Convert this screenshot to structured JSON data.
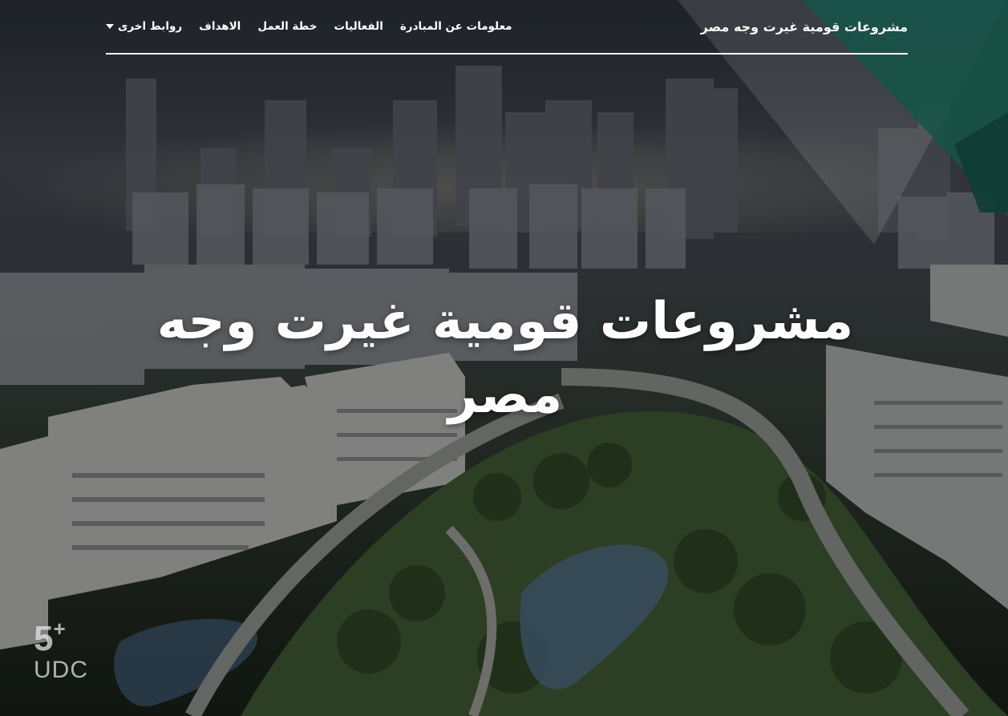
{
  "brand": {
    "title": "مشروعات قومية غيرت وجه مصر"
  },
  "nav": {
    "items": [
      {
        "label": "معلومات عن المبادرة"
      },
      {
        "label": "الفعاليات"
      },
      {
        "label": "خطة العمل"
      },
      {
        "label": "الاهداف"
      },
      {
        "label": "روابط اخرى",
        "dropdown": true
      }
    ]
  },
  "hero": {
    "headline": "مشروعات قومية غيرت وجه مصر"
  },
  "watermark": {
    "number": "5",
    "plus": "+",
    "text": "UDC"
  },
  "colors": {
    "accent_teal": "#1f7a68",
    "nav_text": "#ffffff",
    "divider": "#ffffff"
  },
  "icons": {
    "dropdown": "caret-down-icon"
  }
}
